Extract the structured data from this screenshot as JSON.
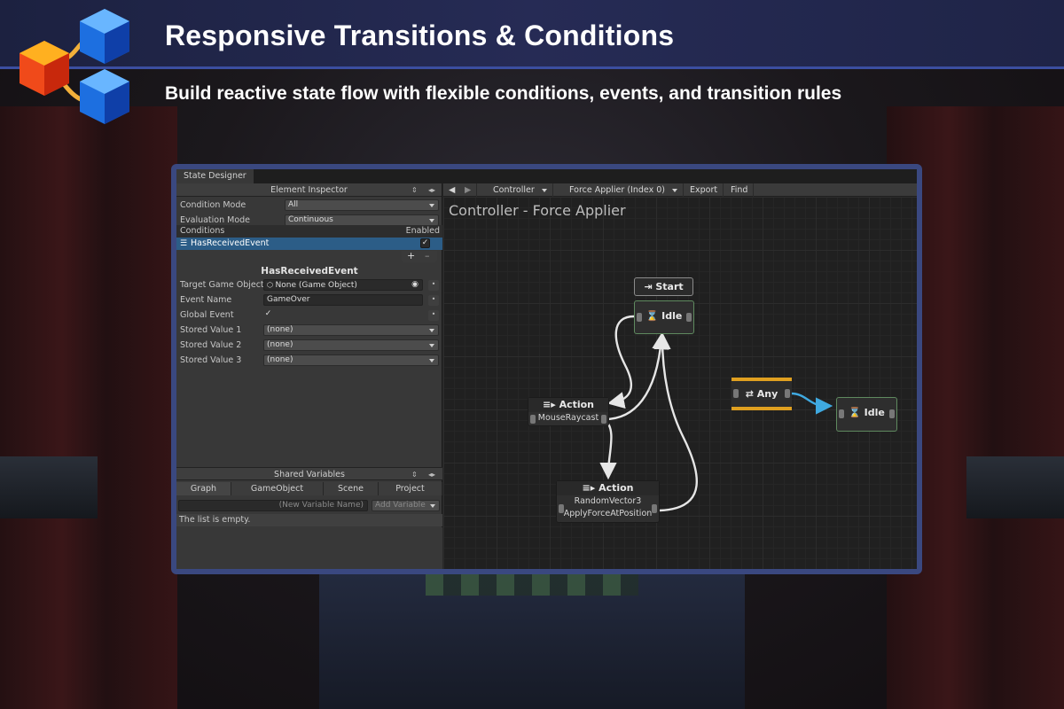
{
  "banner": {
    "title": "Responsive Transitions & Conditions",
    "subtitle": "Build reactive state flow with flexible conditions, events, and transition rules"
  },
  "window": {
    "tab": "State Designer"
  },
  "inspector": {
    "header": "Element Inspector",
    "condition_mode_label": "Condition Mode",
    "condition_mode_value": "All",
    "evaluation_mode_label": "Evaluation Mode",
    "evaluation_mode_value": "Continuous",
    "conditions_header": "Conditions",
    "enabled_header": "Enabled",
    "conditions": [
      {
        "label": "HasReceivedEvent",
        "enabled": true,
        "selected": true
      }
    ],
    "plus": "+",
    "minus": "–",
    "detail_title": "HasReceivedEvent",
    "target_label": "Target Game Object",
    "target_value": "None (Game Object)",
    "event_name_label": "Event Name",
    "event_name_value": "GameOver",
    "global_event_label": "Global Event",
    "global_event_checked": true,
    "stored_values": [
      {
        "label": "Stored Value 1",
        "value": "(none)"
      },
      {
        "label": "Stored Value 2",
        "value": "(none)"
      },
      {
        "label": "Stored Value 3",
        "value": "(none)"
      }
    ],
    "shared_header": "Shared Variables",
    "shared_tabs": [
      "Graph",
      "GameObject",
      "Scene",
      "Project"
    ],
    "new_var_placeholder": "(New Variable Name)",
    "add_variable": "Add Variable",
    "empty_text": "The list is empty."
  },
  "toolbar": {
    "controller": "Controller",
    "component": "Force Applier (Index 0)",
    "export": "Export",
    "find": "Find"
  },
  "graph": {
    "title": "Controller - Force Applier",
    "start_label": "Start",
    "idle_label": "Idle",
    "action1_title": "Action",
    "action1_items": [
      "MouseRaycast"
    ],
    "action2_title": "Action",
    "action2_items": [
      "RandomVector3",
      "ApplyForceAtPosition"
    ],
    "any_label": "Any",
    "idle2_label": "Idle"
  },
  "colors": {
    "banner": "#262b55",
    "window_border": "#3a4880",
    "selection": "#2c5d87",
    "any_bar": "#e0a020",
    "link_blue": "#3fa9e0",
    "state_border": "#5f8a5f"
  }
}
